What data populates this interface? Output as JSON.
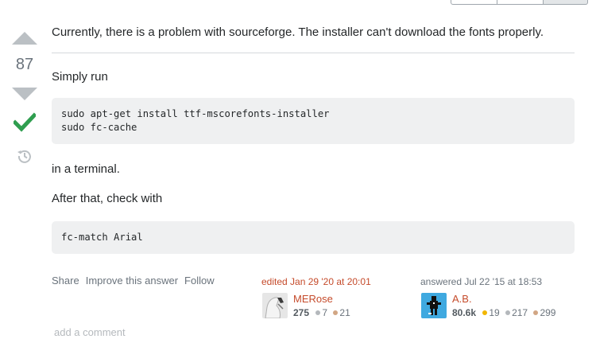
{
  "vote": {
    "count": "87"
  },
  "post": {
    "intro": "Currently, there is a problem with sourceforge. The installer can't download the fonts properly.",
    "simply_run": "Simply run",
    "code1": [
      "sudo apt-get install ttf-mscorefonts-installer",
      "sudo fc-cache"
    ],
    "in_terminal": "in a terminal.",
    "after_that": "After that, check with",
    "code2": [
      "fc-match Arial"
    ]
  },
  "menu": {
    "share": "Share",
    "improve": "Improve this answer",
    "follow": "Follow"
  },
  "editor": {
    "action": "edited Jan 29 '20 at 20:01",
    "name": "MERose",
    "reputation": "275",
    "silver": "7",
    "bronze": "21"
  },
  "answerer": {
    "action": "answered Jul 22 '15 at 18:53",
    "name": "A.B.",
    "reputation": "80.6k",
    "gold": "19",
    "silver": "217",
    "bronze": "299"
  },
  "comments": {
    "add_label": "add a comment"
  },
  "colors": {
    "gold": "#f1b600",
    "silver": "#b4b8bc",
    "bronze": "#d1a684",
    "accepted": "#2f9e4f",
    "link": "#c54b2b"
  },
  "icons": [
    "vote-up-arrow-icon",
    "vote-down-arrow-icon",
    "accepted-checkmark-icon",
    "history-icon"
  ]
}
